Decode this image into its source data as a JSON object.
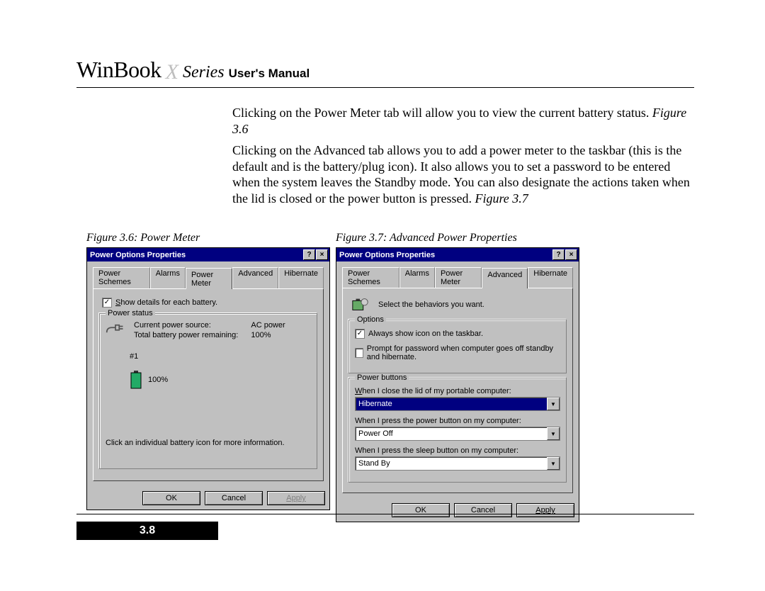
{
  "header": {
    "brand_main": "WinBook",
    "brand_x": "X",
    "brand_series": "Series",
    "brand_suffix": "User's Manual"
  },
  "paragraphs": {
    "p1_a": "Clicking on the Power Meter tab will allow you to view the current battery status. ",
    "p1_ref": "Figure 3.6",
    "p2_a": "Clicking on the Advanced tab allows you to add a power meter to the taskbar (this is the default and is the battery/plug icon). It also allows you to set a password to be entered when the system leaves the Standby mode. You can also designate the actions taken when the lid is closed or the power button is pressed. ",
    "p2_ref": "Figure 3.7"
  },
  "fig_left": {
    "caption": "Figure 3.6: Power Meter",
    "dialog_title": "Power Options Properties",
    "tabs": [
      "Power Schemes",
      "Alarms",
      "Power Meter",
      "Advanced",
      "Hibernate"
    ],
    "active_tab": "Power Meter",
    "show_details_label_pre": "S",
    "show_details_label_rest": "how details for each battery.",
    "groupbox_title": "Power status",
    "row1_label": "Current power source:",
    "row1_value": "AC power",
    "row2_label": "Total battery power remaining:",
    "row2_value": "100%",
    "batt_num": "#1",
    "batt_pct": "100%",
    "hint": "Click an individual battery icon for more information.",
    "ok": "OK",
    "cancel": "Cancel",
    "apply": "Apply"
  },
  "fig_right": {
    "caption": "Figure 3.7: Advanced Power Properties",
    "dialog_title": "Power Options Properties",
    "tabs": [
      "Power Schemes",
      "Alarms",
      "Power Meter",
      "Advanced",
      "Hibernate"
    ],
    "active_tab": "Advanced",
    "select_behaviors": "Select the behaviors you want.",
    "options_title": "Options",
    "opt1": "Always show icon on the taskbar.",
    "opt2": "Prompt for password when computer goes off standby and hibernate.",
    "pb_title": "Power buttons",
    "lid_label": "When I close the lid of my portable computer:",
    "lid_value": "Hibernate",
    "power_label": "When I press the power button on my computer:",
    "power_value": "Power Off",
    "sleep_label": "When I press the sleep button on my computer:",
    "sleep_value": "Stand By",
    "ok": "OK",
    "cancel": "Cancel",
    "apply": "Apply"
  },
  "page_number": "3.8"
}
